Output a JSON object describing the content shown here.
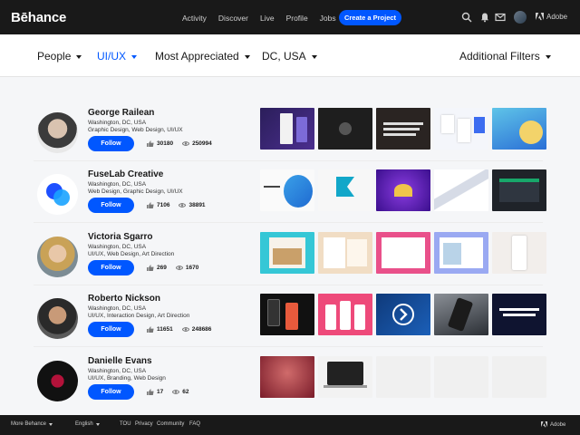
{
  "app": {
    "logo": "Bēhance"
  },
  "nav": {
    "items": [
      "Activity",
      "Discover",
      "Live",
      "Profile",
      "Jobs"
    ],
    "cta": "Create a Project",
    "adobe": "Adobe"
  },
  "filters": {
    "people": "People",
    "category": "UI/UX",
    "sort": "Most Appreciated",
    "location": "DC, USA",
    "additional": "Additional Filters"
  },
  "follow_label": "Follow",
  "creatives": [
    {
      "name": "George Railean",
      "location": "Washington, DC, USA",
      "fields": "Graphic Design, Web Design, UI/UX",
      "appreciations": "30180",
      "views": "250994"
    },
    {
      "name": "FuseLab Creative",
      "location": "Washington, DC, USA",
      "fields": "Web Design, Graphic Design, UI/UX",
      "appreciations": "7106",
      "views": "38891"
    },
    {
      "name": "Victoria Sgarro",
      "location": "Washington, DC, USA",
      "fields": "UI/UX, Web Design, Art Direction",
      "appreciations": "269",
      "views": "1670"
    },
    {
      "name": "Roberto Nickson",
      "location": "Washington, DC, USA",
      "fields": "UI/UX, Interaction Design, Art Direction",
      "appreciations": "11651",
      "views": "248686"
    },
    {
      "name": "Danielle Evans",
      "location": "Washington, DC, USA",
      "fields": "UI/UX, Branding, Web Design",
      "appreciations": "17",
      "views": "62"
    }
  ],
  "footer": {
    "more": "More Behance",
    "language": "English",
    "tou": "TOU",
    "privacy": "Privacy",
    "community": "Community",
    "faq": "FAQ",
    "adobe": "Adobe"
  },
  "colors": {
    "accent": "#0057ff",
    "topbar": "#191919"
  }
}
